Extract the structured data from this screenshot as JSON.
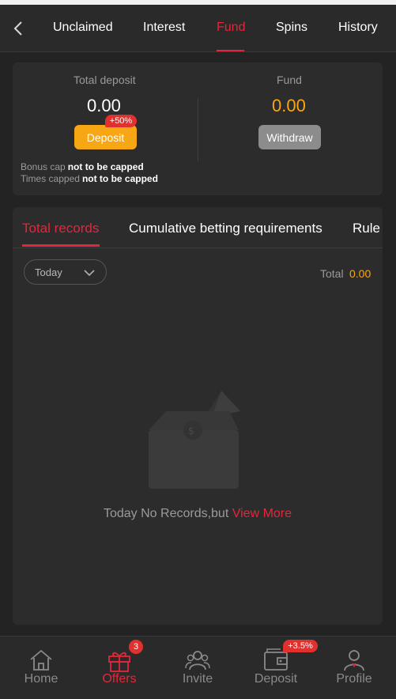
{
  "header": {
    "tabs": [
      {
        "label": "Unclaimed"
      },
      {
        "label": "Interest"
      },
      {
        "label": "Fund"
      },
      {
        "label": "Spins"
      },
      {
        "label": "History"
      }
    ],
    "active_tab": "Fund"
  },
  "summary": {
    "total_deposit_label": "Total deposit",
    "total_deposit_value": "0.00",
    "deposit_button": "Deposit",
    "deposit_badge": "+50%",
    "fund_label": "Fund",
    "fund_value": "0.00",
    "withdraw_button": "Withdraw",
    "bonus_cap_label": "Bonus cap",
    "bonus_cap_value": "not to be capped",
    "times_capped_label": "Times capped",
    "times_capped_value": "not to be capped"
  },
  "records": {
    "tabs": [
      {
        "label": "Total records"
      },
      {
        "label": "Cumulative betting requirements"
      },
      {
        "label": "Rule"
      }
    ],
    "date_filter": "Today",
    "total_label": "Total",
    "total_value": "0.00",
    "empty_text": "Today No Records,but",
    "view_more": "View More"
  },
  "bottom_nav": {
    "items": [
      {
        "label": "Home",
        "icon": "home-icon"
      },
      {
        "label": "Offers",
        "icon": "gift-icon",
        "badge": "3"
      },
      {
        "label": "Invite",
        "icon": "people-icon"
      },
      {
        "label": "Deposit",
        "icon": "wallet-icon",
        "badge": "+3.5%"
      },
      {
        "label": "Profile",
        "icon": "person-icon"
      }
    ],
    "active": "Offers"
  },
  "colors": {
    "accent": "#e5263a",
    "gold": "#f7a713",
    "background": "#232323",
    "card": "#2c2c2c"
  }
}
